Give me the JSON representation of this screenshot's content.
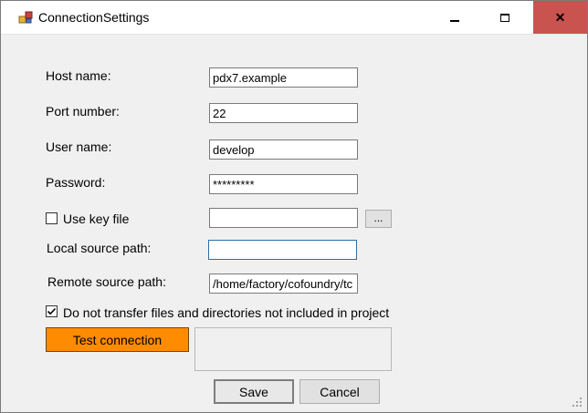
{
  "window": {
    "title": "ConnectionSettings",
    "buttons": {
      "minimize": "minimize",
      "maximize": "maximize",
      "close": "close"
    }
  },
  "form": {
    "host": {
      "label": "Host name:",
      "value": "pdx7.example"
    },
    "port": {
      "label": "Port number:",
      "value": "22"
    },
    "user": {
      "label": "User name:",
      "value": "develop"
    },
    "password": {
      "label": "Password:",
      "value": "*********"
    },
    "keyfile": {
      "label": "Use key file",
      "checked": false,
      "value": "",
      "browse_label": "..."
    },
    "local_path": {
      "label": "Local source path:",
      "value": ""
    },
    "remote_path": {
      "label": "Remote source path:",
      "value": "/home/factory/cofoundry/tc"
    },
    "no_transfer": {
      "label": "Do not transfer files and directories not included in project",
      "checked": true
    }
  },
  "actions": {
    "test_label": "Test connection",
    "status_text": "",
    "save_label": "Save",
    "cancel_label": "Cancel"
  },
  "colors": {
    "test_button": "#ff8c00",
    "close_button": "#c9544f",
    "focus_border": "#2f6fa6"
  }
}
